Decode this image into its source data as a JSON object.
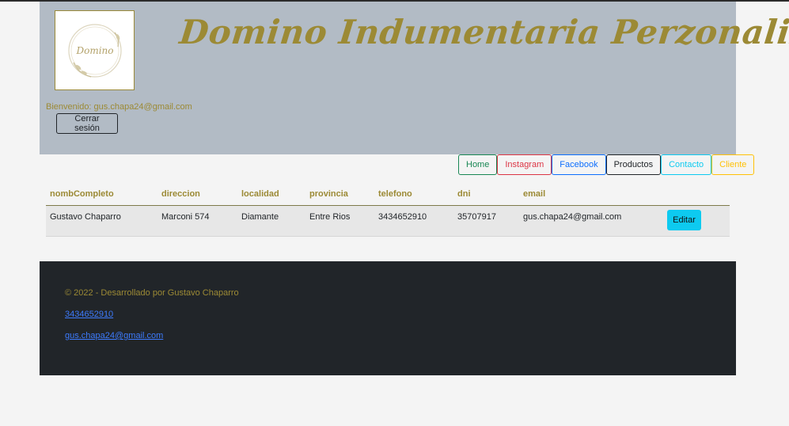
{
  "header": {
    "logo_text": "Domino",
    "brand_title": "Domino Indumentaria Perzonalizada",
    "welcome_text": "Bienvenido: gus.chapa24@gmail.com",
    "logout_label": "Cerrar sesión"
  },
  "nav": {
    "items": [
      {
        "label": "Home",
        "color": "#198754"
      },
      {
        "label": "Instagram",
        "color": "#dc3545"
      },
      {
        "label": "Facebook",
        "color": "#0d6efd"
      },
      {
        "label": "Productos",
        "color": "#212529"
      },
      {
        "label": "Contacto",
        "color": "#0dcaf0"
      },
      {
        "label": "Cliente",
        "color": "#ffc107"
      }
    ]
  },
  "table": {
    "headers": [
      "nombCompleto",
      "direccion",
      "localidad",
      "provincia",
      "telefono",
      "dni",
      "email"
    ],
    "rows": [
      {
        "nombCompleto": "Gustavo Chaparro",
        "direccion": "Marconi 574",
        "localidad": "Diamante",
        "provincia": "Entre Rios",
        "telefono": "3434652910",
        "dni": "35707917",
        "email": "gus.chapa24@gmail.com",
        "action_label": "Editar"
      }
    ]
  },
  "footer": {
    "copyright": "© 2022 - Desarrollado por Gustavo Chaparro",
    "phone": "3434652910",
    "email": "gus.chapa24@gmail.com"
  },
  "colors": {
    "accent_gold": "#9c8a35",
    "header_bg": "#b2bbc5",
    "footer_bg": "#212529",
    "edit_button": "#0dcaf0"
  }
}
